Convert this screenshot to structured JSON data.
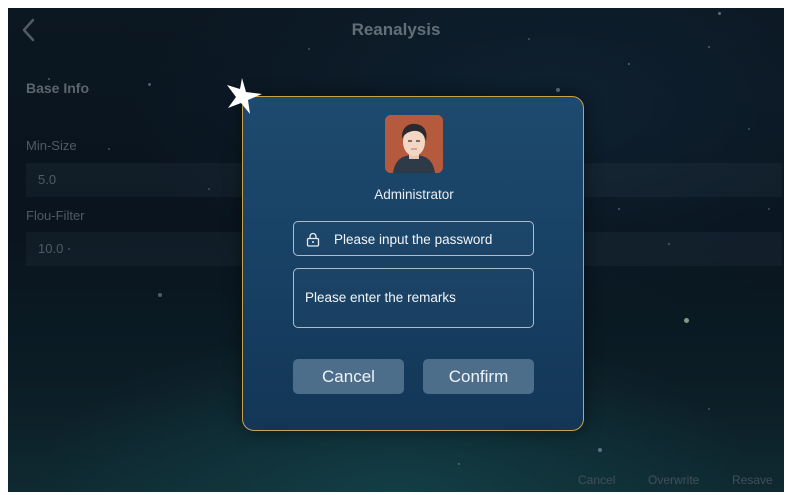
{
  "header": {
    "title": "Reanalysis",
    "back_icon": "chevron-left-icon"
  },
  "form": {
    "section_title": "Base Info",
    "fields": [
      {
        "label": "Min-Size",
        "value": "5.0"
      },
      {
        "label": "Flou-Filter",
        "value": "10.0"
      }
    ]
  },
  "footer": {
    "cancel": "Cancel",
    "overwrite": "Overwrite",
    "resave": "Resave"
  },
  "dialog": {
    "avatar_icon": "admin-avatar",
    "role": "Administrator",
    "password_placeholder": "Please input the password",
    "password_value": "",
    "remarks_placeholder": "Please enter the remarks",
    "remarks_value": "",
    "cancel_label": "Cancel",
    "confirm_label": "Confirm",
    "border_color": "#c9a24a",
    "button_color": "#4d6e8a"
  }
}
